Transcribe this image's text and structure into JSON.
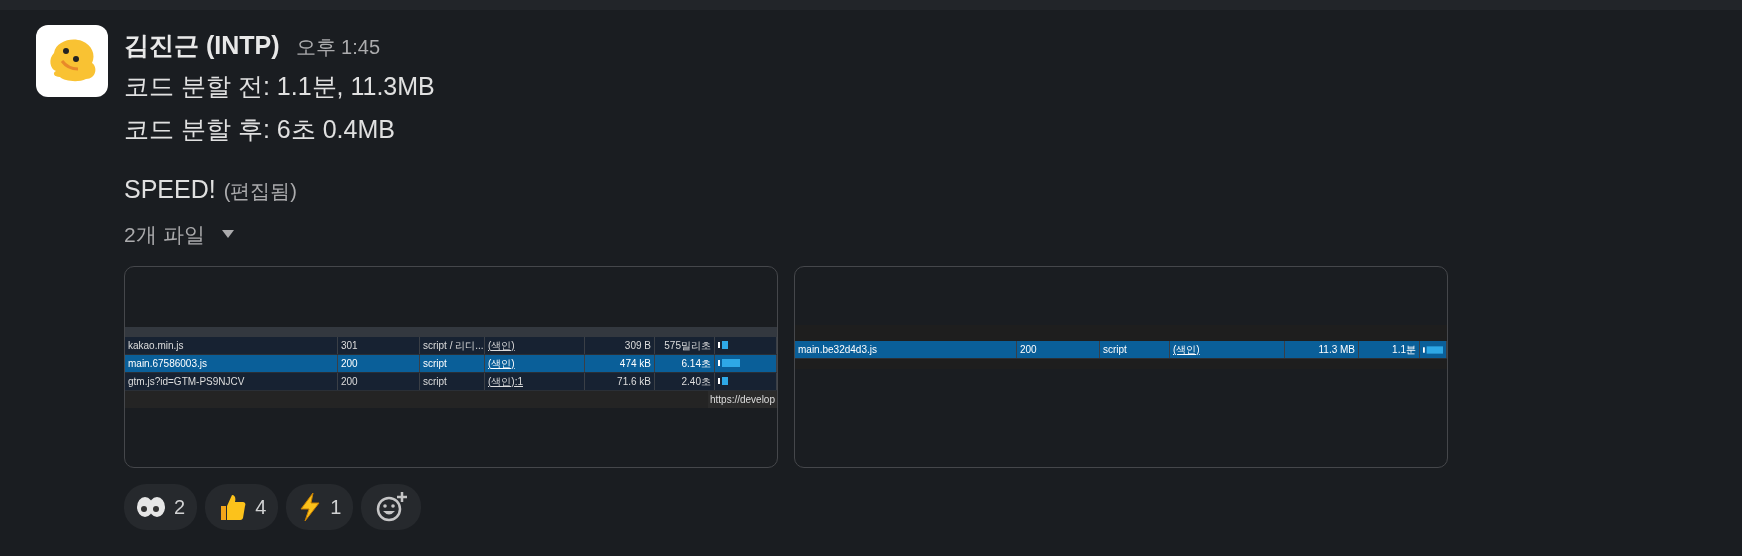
{
  "message": {
    "author": "김진근 (INTP)",
    "time": "오후 1:45",
    "lines": [
      "코드 분할 전: 1.1분, 11.3MB",
      "코드 분할 후: 6초 0.4MB"
    ],
    "speed_text": "SPEED!",
    "edited": "(편집됨)"
  },
  "files": {
    "label": "2개 파일",
    "expanded": true,
    "previews": [
      {
        "rows": [
          {
            "cells": [
              "kakao.min.js",
              "301",
              "script / 리디...",
              "(색인)",
              "309 B",
              "575밀리초"
            ],
            "selected": false
          },
          {
            "cells": [
              "main.67586003.js",
              "200",
              "script",
              "(색인)",
              "474 kB",
              "6.14초"
            ],
            "selected": true
          },
          {
            "cells": [
              "gtm.js?id=GTM-PS9NJCV",
              "200",
              "script",
              "(색인):1",
              "71.6 kB",
              "2.40초"
            ],
            "selected": false
          }
        ],
        "tooltip": "https://develop"
      },
      {
        "rows": [
          {
            "cells": [
              "main.be32d4d3.js",
              "200",
              "script",
              "(색인)",
              "11.3 MB",
              "1.1분"
            ],
            "selected": true
          }
        ]
      }
    ]
  },
  "reactions": [
    {
      "kind": "eyes",
      "count": "2"
    },
    {
      "kind": "thumbs",
      "count": "4"
    },
    {
      "kind": "bolt",
      "count": "1"
    }
  ]
}
